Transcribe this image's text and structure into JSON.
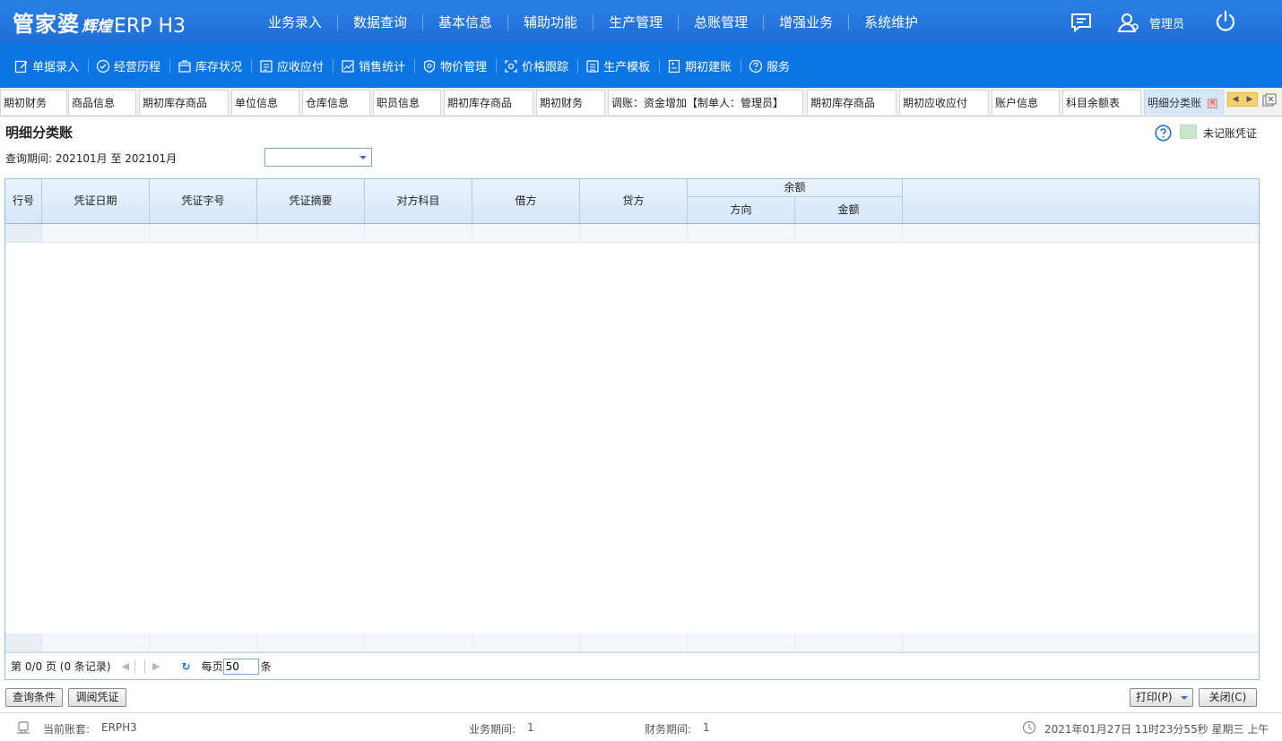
{
  "app": {
    "brand": "管家婆",
    "sub_brand": "辉煌",
    "product": "ERP H3"
  },
  "top_nav": [
    "业务录入",
    "数据查询",
    "基本信息",
    "辅助功能",
    "生产管理",
    "总账管理",
    "增强业务",
    "系统维护"
  ],
  "user": {
    "name": "管理员"
  },
  "toolbar": [
    {
      "label": "单据录入",
      "icon": "edit-icon"
    },
    {
      "label": "经营历程",
      "icon": "check-circle-icon"
    },
    {
      "label": "库存状况",
      "icon": "box-icon"
    },
    {
      "label": "应收应付",
      "icon": "ledger-icon"
    },
    {
      "label": "销售统计",
      "icon": "chart-icon"
    },
    {
      "label": "物价管理",
      "icon": "shield-icon"
    },
    {
      "label": "价格跟踪",
      "icon": "target-icon"
    },
    {
      "label": "生产模板",
      "icon": "template-icon"
    },
    {
      "label": "期初建账",
      "icon": "book-icon"
    },
    {
      "label": "服务",
      "icon": "help-icon"
    }
  ],
  "tabs": [
    {
      "label": "期初财务"
    },
    {
      "label": "商品信息"
    },
    {
      "label": "期初库存商品"
    },
    {
      "label": "单位信息"
    },
    {
      "label": "仓库信息"
    },
    {
      "label": "职员信息"
    },
    {
      "label": "期初库存商品"
    },
    {
      "label": "期初财务"
    },
    {
      "label": "调账：资金增加【制单人：管理员】"
    },
    {
      "label": "期初库存商品"
    },
    {
      "label": "期初应收应付"
    },
    {
      "label": "账户信息"
    },
    {
      "label": "科目余额表"
    },
    {
      "label": "明细分类账"
    }
  ],
  "page": {
    "title": "明细分类账",
    "legend_label": "未记账凭证",
    "legend_color": "#c8e6cc",
    "period_label": "查询期间:  202101月 至 202101月",
    "period_select_value": ""
  },
  "grid": {
    "columns": {
      "row_no": "行号",
      "voucher_date": "凭证日期",
      "voucher_no": "凭证字号",
      "summary": "凭证摘要",
      "counter_account": "对方科目",
      "debit": "借方",
      "credit": "贷方",
      "balance": "余额",
      "direction": "方向",
      "amount": "金额"
    },
    "rows": []
  },
  "pager": {
    "summary": "第 0/0 页 (0 条记录)",
    "per_page_label": "每页",
    "per_page_value": "50",
    "unit": "条"
  },
  "buttons": {
    "query": "查询条件",
    "view_voucher": "调阅凭证",
    "print": "打印(P)",
    "close": "关闭(C)"
  },
  "status": {
    "account_set_label": "当前账套:",
    "account_set": "ERPH3",
    "business_period_label": "业务期间:",
    "business_period": "1",
    "finance_period_label": "财务期间:",
    "finance_period": "1",
    "datetime": "2021年01月27日 11时23分55秒 星期三 上午"
  },
  "colors": {
    "topbar": "#2b7fe3",
    "toolbar": "#0d74e3",
    "active_tab": "#d4e7fb"
  }
}
